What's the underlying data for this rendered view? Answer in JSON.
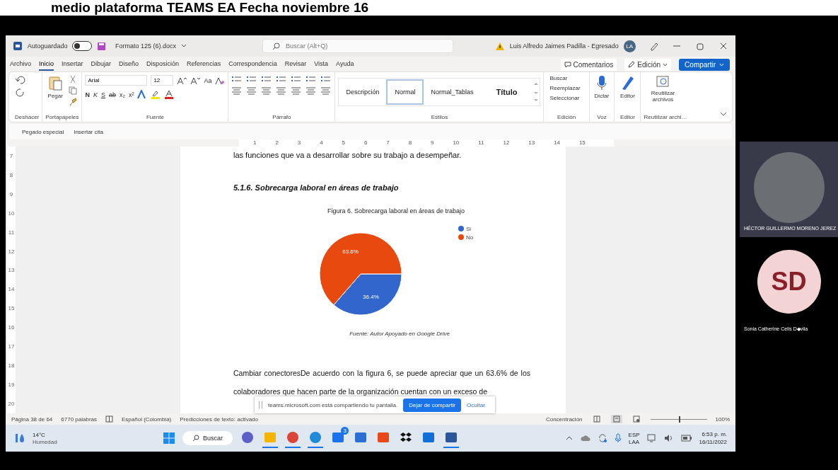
{
  "meeting_caption": "medio plataforma TEAMS EA Fecha noviembre 16",
  "word": {
    "title_bar": {
      "autosave_label": "Autoguardado",
      "autosave_on": false,
      "filename": "Formato 125 (6).docx",
      "search_placeholder": "Buscar (Alt+Q)",
      "user": "Luis Alfredo Jaimes Padilla - Egresado",
      "avatar_initials": "LA"
    },
    "menu_tabs": [
      {
        "label": "Archivo",
        "selected": false
      },
      {
        "label": "Inicio",
        "selected": true
      },
      {
        "label": "Insertar",
        "selected": false
      },
      {
        "label": "Dibujar",
        "selected": false
      },
      {
        "label": "Diseño",
        "selected": false
      },
      {
        "label": "Disposición",
        "selected": false
      },
      {
        "label": "Referencias",
        "selected": false
      },
      {
        "label": "Correspondencia",
        "selected": false
      },
      {
        "label": "Revisar",
        "selected": false
      },
      {
        "label": "Vista",
        "selected": false
      },
      {
        "label": "Ayuda",
        "selected": false
      }
    ],
    "actions": {
      "comments": "Comentarios",
      "editing": "Edición",
      "share": "Compartir"
    },
    "ribbon": {
      "undo_group": "Deshacer",
      "clipboard": {
        "paste": "Pegar",
        "group": "Portapapeles"
      },
      "font": {
        "name": "Arial",
        "size": "12",
        "case_button": "Aa",
        "buttons": [
          "N",
          "K",
          "S",
          "ab",
          "x₂",
          "x²"
        ],
        "group": "Fuente"
      },
      "paragraph": {
        "group": "Párrafo"
      },
      "styles": {
        "items": [
          {
            "label": "Descripción",
            "selected": false
          },
          {
            "label": "Normal",
            "selected": true
          },
          {
            "label": "Normal_Tablas",
            "selected": false
          },
          {
            "label": "Título",
            "selected": false
          }
        ],
        "group": "Estilos"
      },
      "editing": {
        "items": [
          "Buscar",
          "Reemplazar",
          "Seleccionar"
        ],
        "group": "Edición"
      },
      "voice": {
        "button": "Dictar",
        "group": "Voz"
      },
      "editor": {
        "button": "Editor",
        "group": "Editor"
      },
      "reuse": {
        "button": "Reutilizar archivos",
        "group": "Reutilizar archi…"
      }
    },
    "quick_access": [
      "Pegado especial",
      "Insertar cita"
    ],
    "ruler_marks": [
      "1",
      "2",
      "3",
      "4",
      "5",
      "6",
      "7",
      "8",
      "9",
      "10",
      "11",
      "12",
      "13",
      "14",
      "15"
    ],
    "vertical_ruler_marks": [
      "7",
      "8",
      "9",
      "10",
      "11",
      "12",
      "13",
      "14",
      "15",
      "16",
      "17",
      "18",
      "19",
      "20"
    ],
    "document": {
      "top_line": "las funciones que va a desarrollar sobre su trabajo a desempeñar.",
      "heading": "5.1.6.  Sobrecarga laboral en áreas de trabajo",
      "chart_data": {
        "type": "pie",
        "title": "Figura 6. Sobrecarga laboral en áreas de trabajo",
        "categories": [
          "Si",
          "No"
        ],
        "series": [
          {
            "values": [
              36.4,
              63.6
            ]
          }
        ],
        "colors": [
          "#3366cc",
          "#e8490f"
        ],
        "value_labels": [
          "36.4%",
          "63.6%"
        ],
        "legend": true
      },
      "source": "Fuente:  Autor Apoyado en Google Drive",
      "paragraph": "Cambiar conectoresDe acuerdo con la figura 6, se puede apreciar que un 63.6% de los colaboradores que hacen parte de la organización cuentan con un exceso de"
    },
    "share_bar": {
      "message": "teams.microsoft.com está compartiendo tu pantalla.",
      "stop": "Dejar de compartir",
      "hide": "Ocultar"
    },
    "status_bar": {
      "page": "Página 38 de 64",
      "words": "6770 palabras",
      "language": "Español (Colombia)",
      "predictions": "Predicciones de texto: activado",
      "focus": "Concentración",
      "view_modes": [
        {
          "kind": "read",
          "selected": false
        },
        {
          "kind": "print",
          "selected": true
        },
        {
          "kind": "web",
          "selected": false
        }
      ],
      "level": 0.5,
      "zoom": "100%"
    },
    "taskbar": {
      "temperature": "14°C",
      "weather": "Humedad",
      "search": "Buscar",
      "apps": [
        {
          "kind": "chat",
          "running": false
        },
        {
          "kind": "folder",
          "running": true
        },
        {
          "kind": "chrome",
          "running": true
        },
        {
          "kind": "edge",
          "running": true
        },
        {
          "kind": "mail",
          "running": false,
          "badge": "3"
        },
        {
          "kind": "blue",
          "running": false
        },
        {
          "kind": "office",
          "running": false
        },
        {
          "kind": "dropbox",
          "running": false
        },
        {
          "kind": "remote",
          "running": false
        },
        {
          "kind": "word",
          "running": true
        }
      ],
      "language": "ESP",
      "language_sub": "LAA",
      "time": "6:53 p. m.",
      "date": "16/11/2022"
    }
  },
  "participants": [
    {
      "kind": "video",
      "name": "HÉCTOR GUILLERMO MORENO JEREZ"
    },
    {
      "kind": "avatar",
      "initials": "SD",
      "name": "Sonia Catherine Celis D◆vila"
    }
  ]
}
